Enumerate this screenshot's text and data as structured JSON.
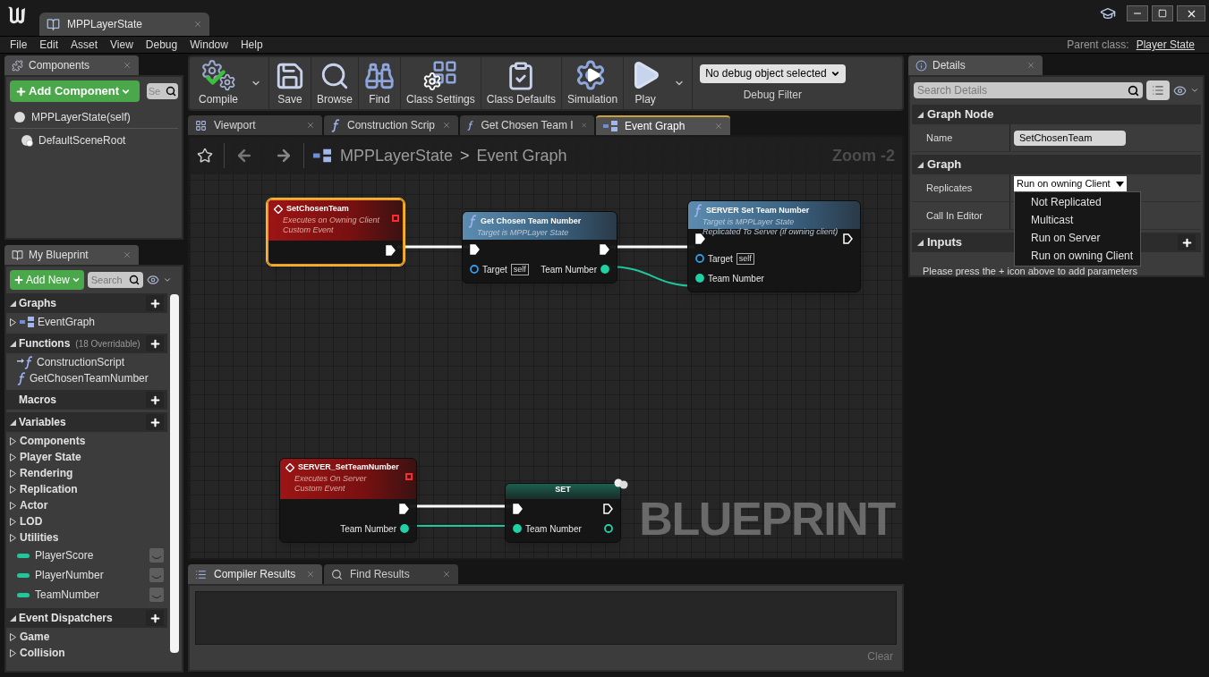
{
  "window": {
    "tab": "MPPLayerState",
    "menu": [
      "File",
      "Edit",
      "Asset",
      "View",
      "Debug",
      "Window",
      "Help"
    ],
    "parent_class_label": "Parent class:",
    "parent_class": "Player State"
  },
  "components": {
    "tab": "Components",
    "add_button": "Add Component",
    "search_placeholder": "Se",
    "tree": [
      {
        "label": "MPPLayerState(self)",
        "children": [
          {
            "label": "DefaultSceneRoot"
          }
        ]
      }
    ]
  },
  "my_blueprint": {
    "tab": "My Blueprint",
    "add_button": "Add New",
    "search_placeholder": "Search",
    "sections": [
      {
        "title": "Graphs",
        "expanded": true,
        "items": [
          {
            "kind": "graph",
            "label": "EventGraph",
            "expanded": false
          }
        ]
      },
      {
        "title": "Functions",
        "note": "(18 Overridable)",
        "expanded": true,
        "items": [
          {
            "kind": "construction",
            "label": "ConstructionScript"
          },
          {
            "kind": "function",
            "label": "GetChosenTeamNumber"
          }
        ]
      },
      {
        "title": "Macros",
        "expanded": false
      },
      {
        "title": "Variables",
        "expanded": true,
        "items": [
          {
            "kind": "category",
            "label": "Components",
            "expanded": false
          },
          {
            "kind": "category",
            "label": "Player State",
            "expanded": false
          },
          {
            "kind": "category",
            "label": "Rendering",
            "expanded": false
          },
          {
            "kind": "category",
            "label": "Replication",
            "expanded": false
          },
          {
            "kind": "category",
            "label": "Actor",
            "expanded": false
          },
          {
            "kind": "category",
            "label": "LOD",
            "expanded": false
          },
          {
            "kind": "category",
            "label": "Utilities",
            "expanded": false
          },
          {
            "kind": "variable",
            "label": "PlayerScore"
          },
          {
            "kind": "variable",
            "label": "PlayerNumber"
          },
          {
            "kind": "variable",
            "label": "TeamNumber"
          }
        ]
      },
      {
        "title": "Event Dispatchers",
        "expanded": true,
        "items": [
          {
            "kind": "category",
            "label": "Game",
            "expanded": false
          },
          {
            "kind": "category",
            "label": "Collision",
            "expanded": false
          }
        ]
      }
    ]
  },
  "toolbar": {
    "buttons": [
      {
        "kind": "compile",
        "label": "Compile",
        "dropdown": true
      },
      {
        "kind": "save",
        "label": "Save",
        "dropdown": false
      },
      {
        "kind": "browse",
        "label": "Browse",
        "dropdown": false
      },
      {
        "kind": "find",
        "label": "Find",
        "dropdown": false
      },
      {
        "kind": "class_settings",
        "label": "Class Settings",
        "dropdown": false
      },
      {
        "kind": "class_defaults",
        "label": "Class Defaults",
        "dropdown": false
      },
      {
        "kind": "simulation",
        "label": "Simulation",
        "dropdown": false
      },
      {
        "kind": "play",
        "label": "Play",
        "dropdown": true
      }
    ],
    "debug_filter": {
      "value": "No debug object selected",
      "label": "Debug Filter"
    }
  },
  "document_tabs": [
    {
      "kind": "viewport",
      "label": "Viewport",
      "selected": false
    },
    {
      "kind": "function",
      "label": "Construction Scrip",
      "selected": false
    },
    {
      "kind": "function",
      "label": "Get Chosen Team I",
      "selected": false
    },
    {
      "kind": "graph",
      "label": "Event Graph",
      "selected": true
    }
  ],
  "graph": {
    "breadcrumb": [
      "MPPLayerState",
      "Event Graph"
    ],
    "separator": ">",
    "zoom": "Zoom -2",
    "watermark": "BLUEPRINT",
    "nodes": [
      {
        "kind": "event",
        "title": "SetChosenTeam",
        "subtitle": [
          "Executes on Owning Client",
          "Custom Event"
        ],
        "selected": true,
        "rows": [
          {
            "right": {
              "kind": "exec",
              "connected": true
            }
          }
        ]
      },
      {
        "kind": "function",
        "title": "Get Chosen Team Number",
        "subtitle": [
          "Target is MPPLayer State"
        ],
        "selected": false,
        "rows": [
          {
            "left": {
              "kind": "exec",
              "connected": true
            },
            "right": {
              "kind": "exec",
              "connected": true
            }
          },
          {
            "left": {
              "kind": "object",
              "label": "Target",
              "default": "self",
              "connected": false
            },
            "right": {
              "kind": "int",
              "label": "Team Number",
              "connected": true
            }
          }
        ]
      },
      {
        "kind": "function",
        "title": "SERVER Set Team Number",
        "subtitle": [
          "Target is MPPLayer State",
          "Replicated To Server (if owning client)"
        ],
        "selected": false,
        "rows": [
          {
            "left": {
              "kind": "exec",
              "connected": true
            },
            "right": {
              "kind": "exec",
              "connected": false
            }
          },
          {
            "left": {
              "kind": "object",
              "label": "Target",
              "default": "self",
              "connected": false
            }
          },
          {
            "left": {
              "kind": "int",
              "label": "Team Number",
              "connected": true
            }
          }
        ]
      },
      {
        "kind": "event",
        "title": "SERVER_SetTeamNumber",
        "subtitle": [
          "Executes On Server",
          "Custom Event"
        ],
        "selected": false,
        "rows": [
          {
            "right": {
              "kind": "exec",
              "connected": true
            }
          },
          {
            "right": {
              "kind": "int",
              "label": "Team Number",
              "connected": true
            }
          }
        ]
      },
      {
        "kind": "set",
        "title": "SET",
        "selected": false,
        "rows": [
          {
            "left": {
              "kind": "exec",
              "connected": true
            },
            "right": {
              "kind": "exec",
              "connected": false
            }
          },
          {
            "left": {
              "kind": "int",
              "label": "Team Number",
              "connected": true
            },
            "right": {
              "kind": "int",
              "connected": false
            }
          }
        ]
      }
    ]
  },
  "bottom_panel": {
    "tabs": [
      {
        "label": "Compiler Results",
        "kind": "results",
        "selected": true
      },
      {
        "label": "Find Results",
        "kind": "find",
        "selected": false
      }
    ],
    "clear_button": "Clear"
  },
  "details": {
    "tab": "Details",
    "search_placeholder": "Search Details",
    "sections": [
      {
        "title": "Graph Node",
        "rows": [
          {
            "kind": "text",
            "label": "Name",
            "value": "SetChosenTeam"
          }
        ]
      },
      {
        "title": "Graph",
        "rows": [
          {
            "kind": "dropdown",
            "label": "Replicates",
            "value": "Run on owning Client",
            "open": true,
            "options": [
              "Not Replicated",
              "Multicast",
              "Run on Server",
              "Run on owning Client"
            ]
          },
          {
            "kind": "hidden",
            "label": "Call In Editor"
          }
        ]
      },
      {
        "title": "Inputs",
        "add": true,
        "hint": "Please press the + icon above to add parameters"
      }
    ]
  }
}
